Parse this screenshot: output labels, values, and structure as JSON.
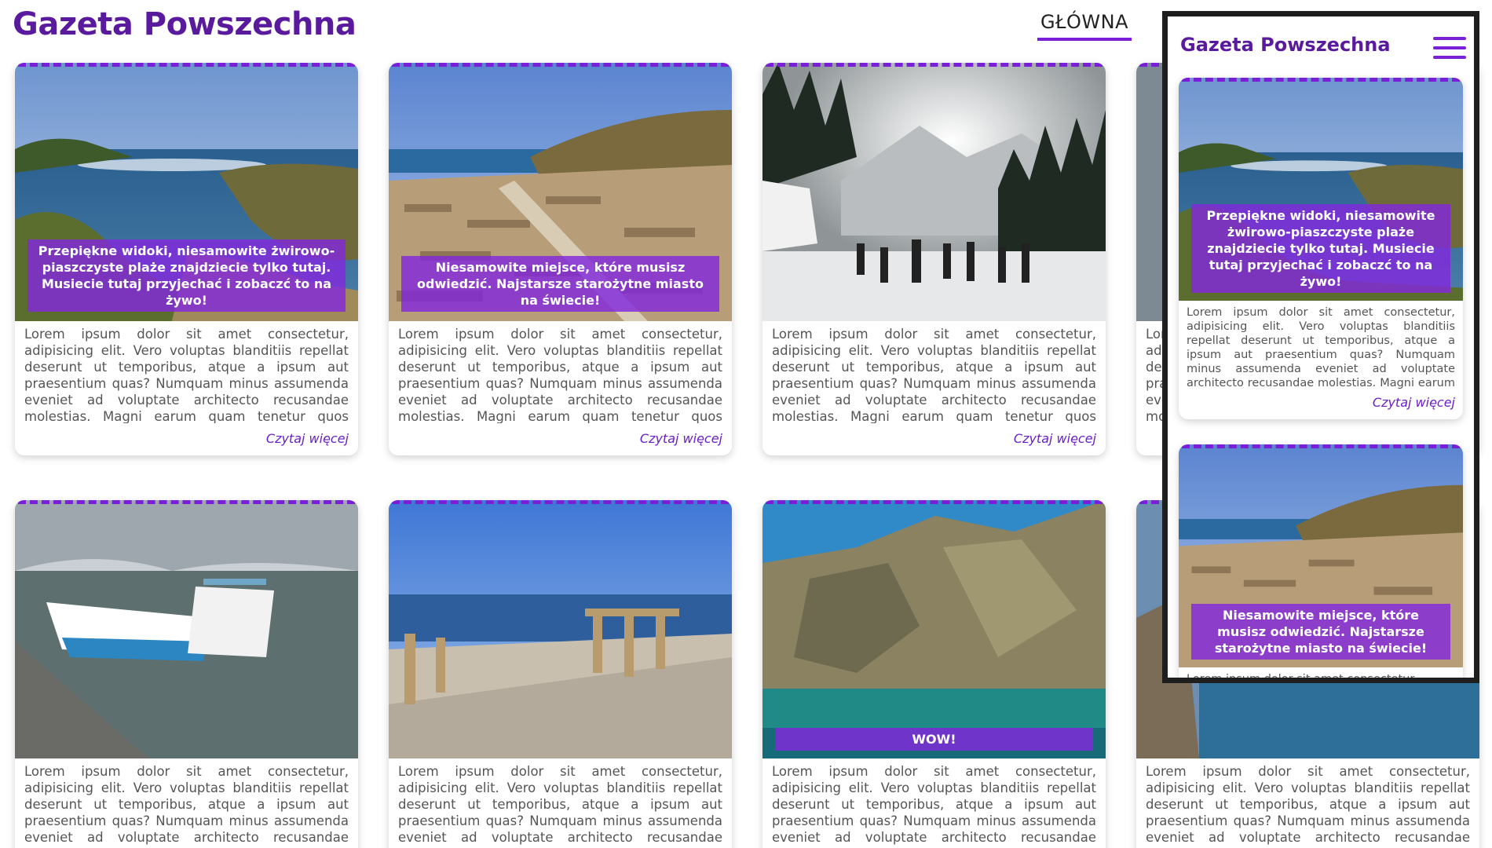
{
  "header": {
    "site_title": "Gazeta Powszechna",
    "nav_active": "GŁÓWNA"
  },
  "colors": {
    "brand": "#5a1a9e",
    "accent": "#7a1fd8",
    "caption_bg": "#8228dc"
  },
  "lorem": "Lorem ipsum dolor sit amet consectetur, adipisicing elit. Vero voluptas blanditiis repellat deserunt ut temporibus, atque a ipsum aut praesentium quas? Numquam minus assumenda eveniet ad voluptate architecto recusandae molestias. Magni earum quam tenetur quos laborum eos saepe veni…",
  "read_more": "Czytaj więcej",
  "cards": [
    {
      "image": "bay-beach",
      "caption": "Przepiękne widoki, niesamowite żwirowo-piaszczyste plaże znajdziecie tylko tutaj. Musiecie tutaj przyjechać i zobaczć to na żywo!"
    },
    {
      "image": "ancient-ruins",
      "caption": "Niesamowite miejsce, które musisz odwiedzić. Najstarsze starożytne miasto na świecie!"
    },
    {
      "image": "snowy-forest",
      "caption": ""
    },
    {
      "image": "partial-card",
      "caption": ""
    },
    {
      "image": "harbor-boats",
      "caption": ""
    },
    {
      "image": "acropolis-columns",
      "caption": ""
    },
    {
      "image": "sea-cliff",
      "caption": "WOW!"
    },
    {
      "image": "rocky-shore",
      "caption": ""
    }
  ],
  "mobile": {
    "title": "Gazeta Powszechna",
    "menu_icon": "hamburger-icon",
    "cards": [
      {
        "image": "bay-beach",
        "caption": "Przepiękne widoki, niesamowite żwirowo-piaszczyste plaże znajdziecie tylko tutaj. Musiecie tutaj przyjechać i zobaczć to na żywo!"
      },
      {
        "image": "ancient-ruins",
        "caption": "Niesamowite miejsce, które musisz odwiedzić. Najstarsze starożytne miasto na świecie!"
      }
    ],
    "partial_text": "Lorem ipsum dolor sit amet consectetur,"
  }
}
